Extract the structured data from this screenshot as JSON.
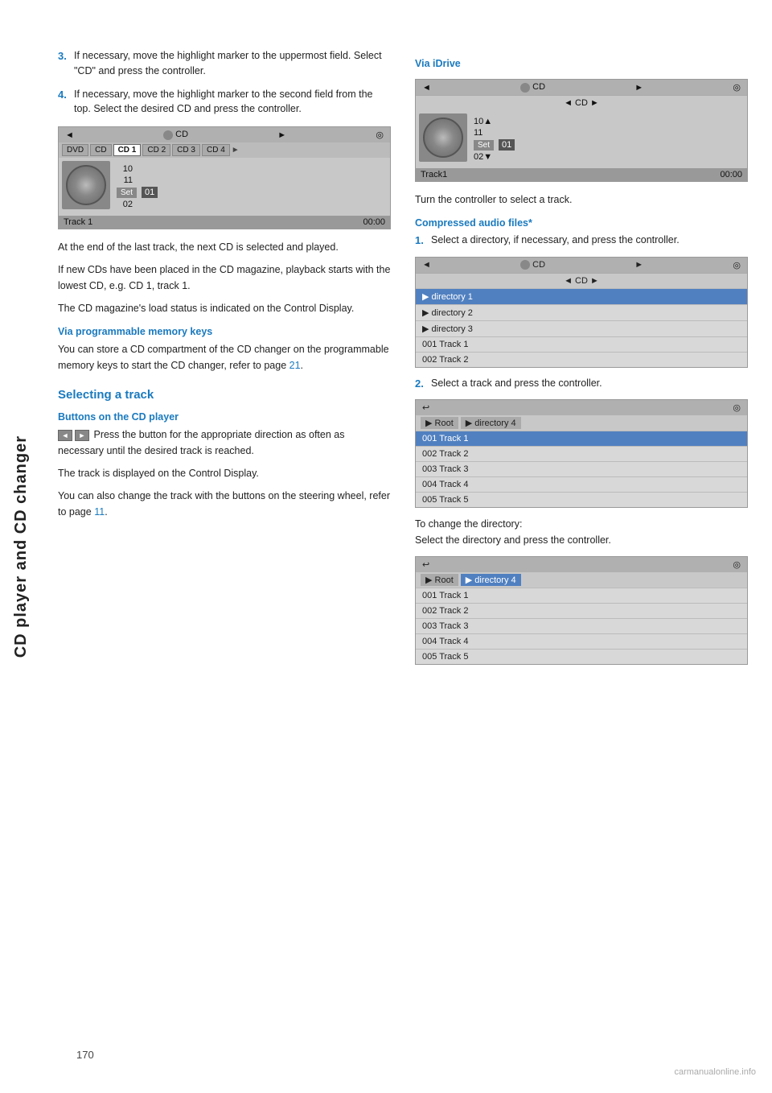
{
  "sidebar": {
    "label": "CD player and CD changer"
  },
  "page_number": "170",
  "watermark": "carmanualonline.info",
  "left_col": {
    "steps": [
      {
        "num": "3.",
        "text": "If necessary, move the highlight marker to the uppermost field. Select \"CD\" and press the controller."
      },
      {
        "num": "4.",
        "text": "If necessary, move the highlight marker to the second field from the top. Select the desired CD and press the controller."
      }
    ],
    "cd_ui_1": {
      "top_bar": {
        "left": "◄",
        "center_icon": "●",
        "center_text": "CD",
        "right": "►",
        "icon_right": "◎"
      },
      "tab_bar_items": [
        "DVD",
        "CD",
        "CD 1",
        "CD 2",
        "CD 3",
        "CD 4"
      ],
      "active_tab": "CD 1",
      "tracks": [
        {
          "num": "10",
          "set": false
        },
        {
          "num": "11",
          "set": false
        },
        {
          "num": "Set",
          "value": "01",
          "set": true
        },
        {
          "num": "02",
          "set": false
        }
      ],
      "bottom_bar_left": "Track 1",
      "bottom_bar_right": "00:00"
    },
    "paragraphs": [
      "At the end of the last track, the next CD is selected and played.",
      "If new CDs have been placed in the CD magazine, playback starts with the lowest CD, e.g. CD 1, track 1.",
      "The CD magazine's load status is indicated on the Control Display."
    ],
    "via_prog_heading": "Via programmable memory keys",
    "via_prog_text": "You can store a CD compartment of the CD changer on the programmable memory keys to start the CD changer, refer to page",
    "via_prog_link": "21",
    "via_prog_period": ".",
    "selecting_track_heading": "Selecting a track",
    "buttons_heading": "Buttons on the CD player",
    "buttons_text_before": "Press the button for the appropriate direction as often as necessary until the desired track is reached.",
    "buttons_text_2": "The track is displayed on the Control Display.",
    "buttons_text_3": "You can also change the track with the buttons on the steering wheel, refer to page",
    "buttons_link": "11",
    "buttons_period": "."
  },
  "right_col": {
    "via_idrive_heading": "Via iDrive",
    "cd_ui_idrive": {
      "top_bar_left": "◄",
      "top_bar_icon": "●",
      "top_bar_cd": "CD",
      "top_bar_right": "►",
      "top_bar_icon_right": "◎",
      "nav_cd": "◄ CD ►",
      "tracks": [
        "10▲",
        "11",
        "Set  01",
        "02▼"
      ],
      "bottom_left": "Track1",
      "bottom_right": "00:00"
    },
    "idrive_text": "Turn the controller to select a track.",
    "compressed_heading": "Compressed audio files*",
    "compressed_steps": [
      {
        "num": "1.",
        "text": "Select a directory, if necessary, and press the controller."
      }
    ],
    "dir_ui": {
      "top_bar_left": "◄",
      "top_bar_icon": "●",
      "top_bar_cd": "CD",
      "top_bar_right": "►",
      "top_bar_icon_right": "◎",
      "nav_cd": "◄ CD ►",
      "items": [
        {
          "label": "▶ directory 1",
          "active": true
        },
        {
          "label": "▶ directory 2",
          "active": false
        },
        {
          "label": "▶ directory 3",
          "active": false
        },
        {
          "label": "001 Track  1",
          "active": false
        },
        {
          "label": "002 Track  2",
          "active": false
        }
      ]
    },
    "step2_text": "Select a track and press the controller.",
    "track_ui_1": {
      "top_icon_left": "↩",
      "top_icon_right": "◎",
      "breadcrumbs": [
        "▶ Root",
        "▶ directory 4"
      ],
      "active_breadcrumb": 0,
      "items": [
        {
          "label": "001 Track  1",
          "active": true
        },
        {
          "label": "002 Track  2",
          "active": false
        },
        {
          "label": "003 Track  3",
          "active": false
        },
        {
          "label": "004 Track  4",
          "active": false
        },
        {
          "label": "005 Track  5",
          "active": false
        }
      ]
    },
    "change_dir_text": "To change the directory:",
    "change_dir_text2": "Select the directory and press the controller.",
    "track_ui_2": {
      "top_icon_left": "↩",
      "top_icon_right": "◎",
      "breadcrumbs": [
        "▶ Root",
        "▶ directory 4"
      ],
      "active_breadcrumb": 1,
      "items": [
        {
          "label": "001 Track  1",
          "active": false
        },
        {
          "label": "002 Track  2",
          "active": false
        },
        {
          "label": "003 Track  3",
          "active": false
        },
        {
          "label": "004 Track  4",
          "active": false
        },
        {
          "label": "005 Track  5",
          "active": false
        }
      ]
    }
  }
}
